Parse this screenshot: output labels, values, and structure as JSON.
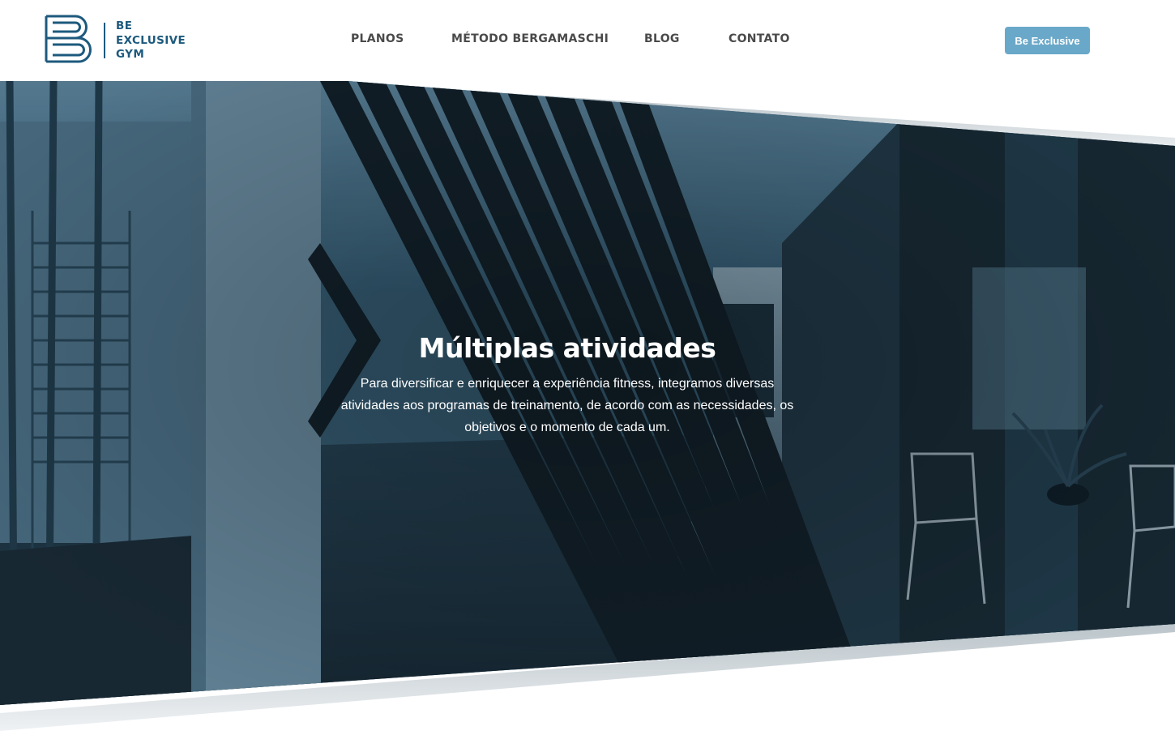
{
  "brand": {
    "name_lines": [
      "BE",
      "EXCLUSIVE",
      "GYM"
    ],
    "logo_icon": "be-monogram-icon",
    "primary_color": "#1d5a7d"
  },
  "nav": {
    "items": [
      {
        "label": "PLANOS"
      },
      {
        "label": "MÉTODO BERGAMASCHI"
      },
      {
        "label": "BLOG"
      },
      {
        "label": "CONTATO"
      }
    ],
    "cta_label": "Be Exclusive",
    "cta_color": "#6aa8c9"
  },
  "hero": {
    "title": "Múltiplas atividades",
    "body": "Para diversificar e enriquecer a experiência fitness, integramos diversas atividades aos programas de treinamento, de acordo com as necessidades, os objetivos e o momento de cada um.",
    "background": "gym-interior-photo-blue-tint",
    "tint_color": "#4d7891"
  }
}
